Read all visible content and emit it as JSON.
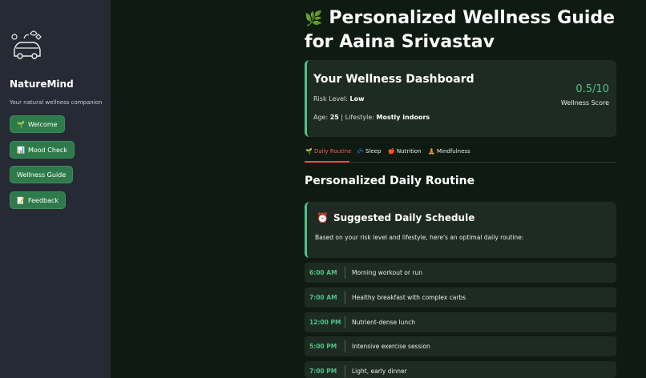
{
  "sidebar": {
    "brand": "NatureMind",
    "tagline": "Your natural wellness companion",
    "nav": [
      {
        "icon": "🌱",
        "label": "Welcome"
      },
      {
        "icon": "📊",
        "label": "Mood Check"
      },
      {
        "icon": "",
        "label": "Wellness Guide"
      },
      {
        "icon": "📝",
        "label": "Feedback"
      }
    ]
  },
  "page": {
    "title_icon": "🌿",
    "title": "Personalized Wellness Guide for Aaina Srivastav"
  },
  "dashboard": {
    "title": "Your Wellness Dashboard",
    "risk_label": "Risk Level:",
    "risk_value": "Low",
    "age_label": "Age:",
    "age_value": "25",
    "lifestyle_label": "| Lifestyle:",
    "lifestyle_value": "Mostly indoors",
    "score": "0.5/10",
    "score_label": "Wellness Score"
  },
  "tabs": [
    {
      "icon": "🌱",
      "label": "Daily Routine",
      "active": true
    },
    {
      "icon": "💤",
      "label": "Sleep",
      "active": false
    },
    {
      "icon": "🍎",
      "label": "Nutrition",
      "active": false
    },
    {
      "icon": "🧘",
      "label": "Mindfulness",
      "active": false
    }
  ],
  "section": {
    "title": "Personalized Daily Routine"
  },
  "schedule": {
    "icon": "⏰",
    "title": "Suggested Daily Schedule",
    "description": "Based on your risk level and lifestyle, here's an optimal daily routine:",
    "items": [
      {
        "time": "6:00 AM",
        "activity": "Morning workout or run"
      },
      {
        "time": "7:00 AM",
        "activity": "Healthy breakfast with complex carbs"
      },
      {
        "time": "12:00 PM",
        "activity": "Nutrient-dense lunch"
      },
      {
        "time": "5:00 PM",
        "activity": "Intensive exercise session"
      },
      {
        "time": "7:00 PM",
        "activity": "Light, early dinner"
      }
    ]
  },
  "colors": {
    "accent": "#4fc28a",
    "button": "#2f7a4a",
    "active_tab": "#ff4b4b",
    "sidebar_bg": "#262a35",
    "main_bg": "#0f1a13"
  }
}
